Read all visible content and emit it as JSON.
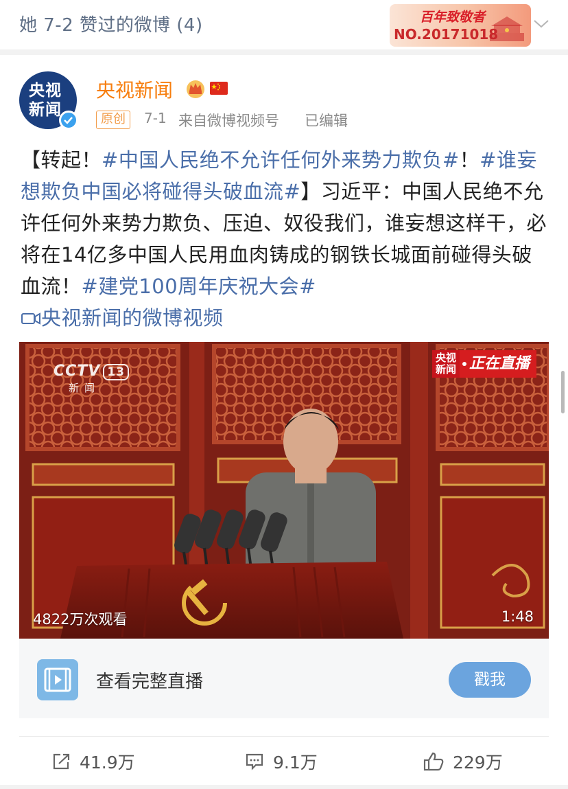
{
  "header": {
    "title": "她 7-2 赞过的微博 (4)",
    "badge_top": "百年致敬者",
    "badge_no": "NO.20171018"
  },
  "post": {
    "author": {
      "name": "央视新闻",
      "avatar_text_1": "央视",
      "avatar_text_2": "新闻"
    },
    "meta": {
      "orig_tag": "原创",
      "date": "7-1",
      "source": "来自微博视频号",
      "edited": "已编辑"
    },
    "text": {
      "p1": "【转起！",
      "topic1": "#中国人民绝不允许任何外来势力欺负#",
      "p2": "！",
      "topic2": "#谁妄想欺负中国必将碰得头破血流#",
      "p3": "】习近平：中国人民绝不允许任何外来势力欺负、压迫、奴役我们，谁妄想这样干，必将在14亿多中国人民用血肉铸成的钢铁长城面前碰得头破血流！",
      "topic3": "#建党100周年庆祝大会#",
      "video_link": "央视新闻的微博视频"
    },
    "video": {
      "channel": "CCTV",
      "channel_num": "13",
      "channel_sub": "新闻",
      "live_news": "央视新闻",
      "live_text": "正在直播",
      "views": "4822万次观看",
      "duration": "1:48"
    },
    "live_card": {
      "title": "查看完整直播",
      "button": "戳我"
    },
    "actions": {
      "repost": "41.9万",
      "comment": "9.1万",
      "like": "229万"
    }
  },
  "colors": {
    "link": "#4a6ea9",
    "author": "#f77e0e",
    "button": "#6ba4de"
  }
}
